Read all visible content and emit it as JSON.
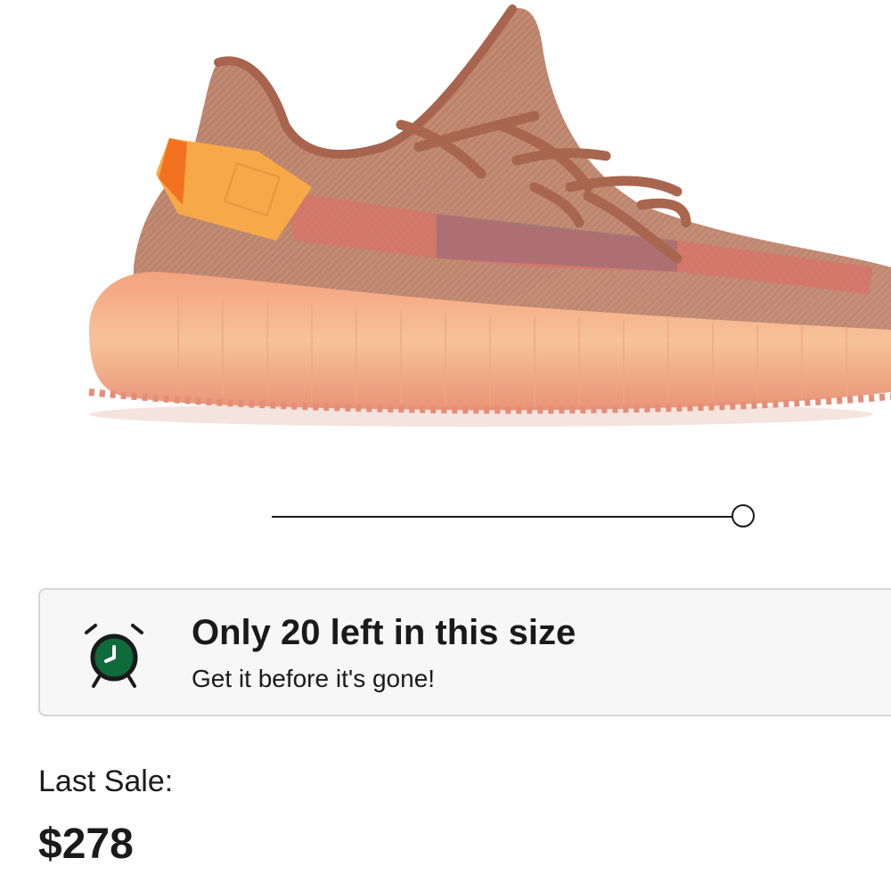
{
  "product": {
    "image_name": "sneaker-product-image"
  },
  "image_slider": {
    "position_fraction": 1.0
  },
  "stock_alert": {
    "icon": "alarm-clock-icon",
    "icon_color": "#0f6b3c",
    "title": "Only 20 left in this size",
    "subtitle": "Get it before it's gone!"
  },
  "last_sale": {
    "label": "Last Sale:",
    "price": "$278"
  }
}
